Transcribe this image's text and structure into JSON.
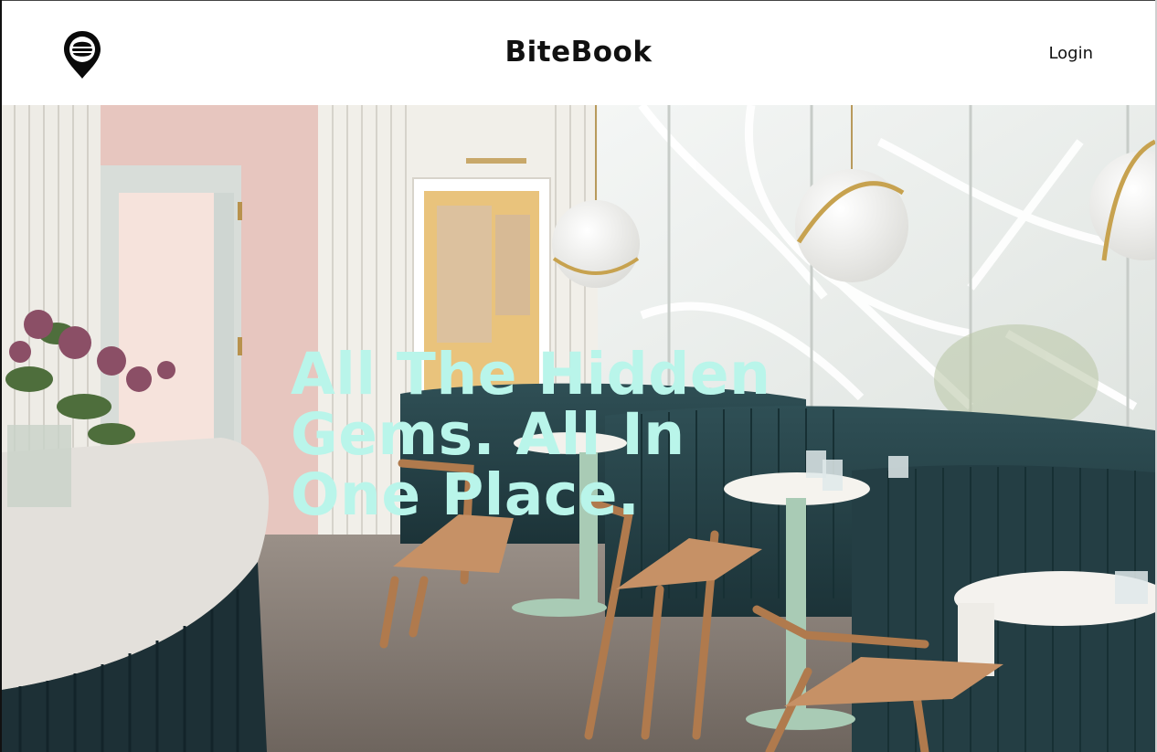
{
  "header": {
    "logo_icon": "map-pin-burger-icon",
    "brand": "BiteBook",
    "login_label": "Login"
  },
  "hero": {
    "tagline": "All The Hidden Gems. All In One Place.",
    "image_subject": "restaurant-interior-photo",
    "tagline_color": "#b9f5ea"
  }
}
